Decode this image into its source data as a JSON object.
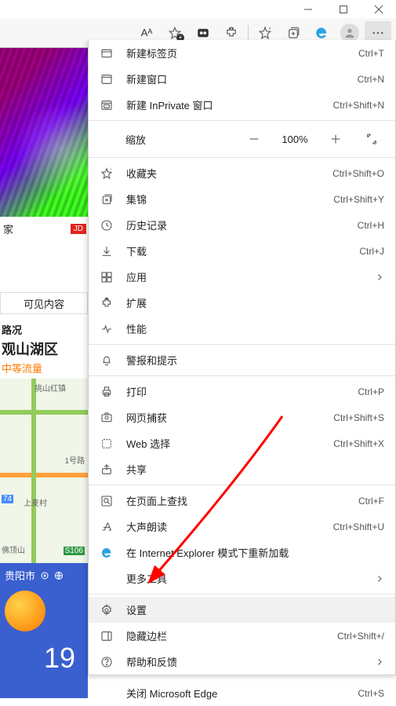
{
  "titlebar": {
    "minimize_name": "minimize",
    "maximize_name": "maximize",
    "close_name": "close"
  },
  "toolbar": {
    "aa_label": "Aᴬ"
  },
  "page": {
    "jia_label": "家",
    "jd_badge": "JD",
    "visible_content_label": "可见内容",
    "traffic_head": "路况",
    "traffic_city": "观山湖区",
    "traffic_level": "中等流量",
    "map": {
      "label_xianhongzhen": "挑山红镇",
      "label_1haolu": "1号路",
      "label_shangmaicun": "上麦村",
      "label_74": "74",
      "label_foding": "佛顶山",
      "label_s106": "S106"
    },
    "weather_city_label": "贵阳市",
    "weather_temp": "19"
  },
  "menu": {
    "new_tab": {
      "label": "新建标签页",
      "shortcut": "Ctrl+T"
    },
    "new_window": {
      "label": "新建窗口",
      "shortcut": "Ctrl+N"
    },
    "new_inprivate": {
      "label": "新建 InPrivate 窗口",
      "shortcut": "Ctrl+Shift+N"
    },
    "zoom": {
      "label": "缩放",
      "value": "100%"
    },
    "favorites": {
      "label": "收藏夹",
      "shortcut": "Ctrl+Shift+O"
    },
    "collections": {
      "label": "集锦",
      "shortcut": "Ctrl+Shift+Y"
    },
    "history": {
      "label": "历史记录",
      "shortcut": "Ctrl+H"
    },
    "downloads": {
      "label": "下载",
      "shortcut": "Ctrl+J"
    },
    "apps": {
      "label": "应用"
    },
    "extensions": {
      "label": "扩展"
    },
    "performance": {
      "label": "性能"
    },
    "alerts": {
      "label": "警报和提示"
    },
    "print": {
      "label": "打印",
      "shortcut": "Ctrl+P"
    },
    "webcapture": {
      "label": "网页捕获",
      "shortcut": "Ctrl+Shift+S"
    },
    "webselect": {
      "label": "Web 选择",
      "shortcut": "Ctrl+Shift+X"
    },
    "share": {
      "label": "共享"
    },
    "find": {
      "label": "在页面上查找",
      "shortcut": "Ctrl+F"
    },
    "readaloud": {
      "label": "大声朗读",
      "shortcut": "Ctrl+Shift+U"
    },
    "iemode": {
      "label": "在 Internet Explorer 模式下重新加载"
    },
    "moretools": {
      "label": "更多工具"
    },
    "settings": {
      "label": "设置"
    },
    "sidebar": {
      "label": "隐藏边栏",
      "shortcut": "Ctrl+Shift+/"
    },
    "help": {
      "label": "帮助和反馈"
    },
    "close_edge": {
      "label": "关闭 Microsoft Edge",
      "shortcut_cut": "Ctrl+S"
    }
  }
}
